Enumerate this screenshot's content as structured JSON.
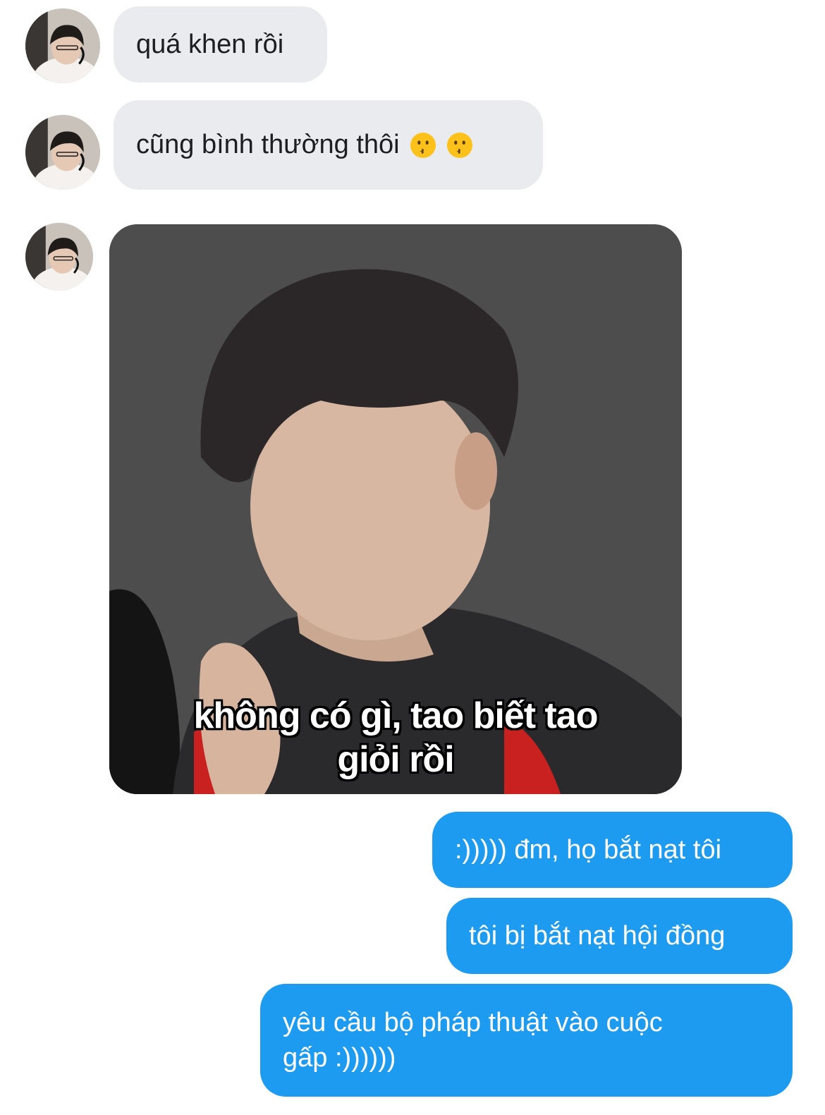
{
  "messages": {
    "m1": {
      "text": "quá khen rồi"
    },
    "m2": {
      "text": "cũng bình thường thôi",
      "emoji": [
        "kissing-face-icon",
        "kissing-face-icon"
      ]
    },
    "m3": {
      "caption_line1": "không có gì, tao biết tao",
      "caption_line2": "giỏi rồi"
    },
    "m4": {
      "text": ":))))) đm, họ bắt nạt tôi"
    },
    "m5": {
      "text": "tôi bị bắt nạt hội đồng"
    },
    "m6": {
      "line1": "yêu cầu bộ pháp thuật vào cuộc",
      "line2": "gấp :))))))"
    }
  },
  "colors": {
    "incoming_bubble": "#e9ebee",
    "outgoing_bubble": "#1d9bf0",
    "background": "#ffffff"
  }
}
